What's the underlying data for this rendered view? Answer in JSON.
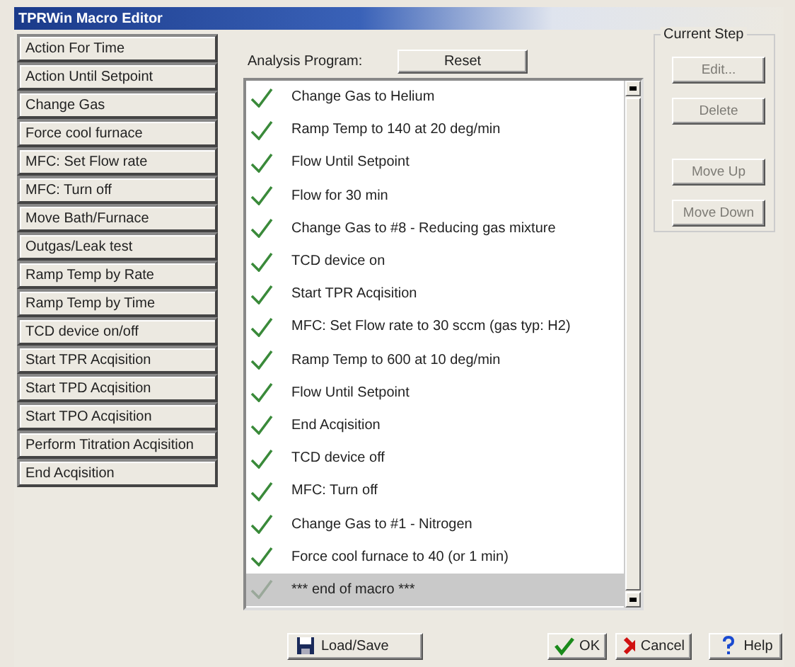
{
  "window": {
    "title": "TPRWin Macro Editor"
  },
  "actions": [
    "Action For Time",
    "Action Until Setpoint",
    "Change Gas",
    "Force cool furnace",
    "MFC: Set Flow rate",
    "MFC: Turn off",
    "Move Bath/Furnace",
    "Outgas/Leak test",
    "Ramp Temp by Rate",
    "Ramp Temp by Time",
    "TCD device on/off",
    "Start TPR Acqisition",
    "Start TPD Acqisition",
    "Start TPO Acqisition",
    "Perform Titration Acqisition",
    "End Acqisition"
  ],
  "program": {
    "label": "Analysis Program:",
    "reset": "Reset",
    "steps": [
      {
        "text": "Change Gas to Helium",
        "selected": false
      },
      {
        "text": "Ramp Temp to 140 at 20 deg/min",
        "selected": false
      },
      {
        "text": "Flow Until Setpoint",
        "selected": false
      },
      {
        "text": "Flow for 30 min",
        "selected": false
      },
      {
        "text": "Change Gas to #8 - Reducing gas mixture",
        "selected": false
      },
      {
        "text": "TCD device on",
        "selected": false
      },
      {
        "text": "Start TPR Acqisition",
        "selected": false
      },
      {
        "text": "MFC: Set Flow rate to 30 sccm (gas typ: H2)",
        "selected": false
      },
      {
        "text": "Ramp Temp to 600 at 10 deg/min",
        "selected": false
      },
      {
        "text": "Flow Until Setpoint",
        "selected": false
      },
      {
        "text": "End Acqisition",
        "selected": false
      },
      {
        "text": "TCD device off",
        "selected": false
      },
      {
        "text": "MFC: Turn off",
        "selected": false
      },
      {
        "text": "Change Gas to #1 - Nitrogen",
        "selected": false
      },
      {
        "text": "Force cool furnace to 40 (or 1 min)",
        "selected": false
      },
      {
        "text": "*** end of macro ***",
        "selected": true
      }
    ]
  },
  "current_step": {
    "title": "Current Step",
    "buttons": [
      {
        "label": "Edit...",
        "disabled": true
      },
      {
        "label": "Delete",
        "disabled": true
      },
      {
        "label": "Move Up",
        "disabled": true
      },
      {
        "label": "Move Down",
        "disabled": true
      }
    ]
  },
  "footer": [
    {
      "kind": "save",
      "label": "Load/Save"
    },
    {
      "kind": "ok",
      "label": "OK"
    },
    {
      "kind": "cancel",
      "label": "Cancel"
    },
    {
      "kind": "help",
      "label": "Help"
    }
  ]
}
